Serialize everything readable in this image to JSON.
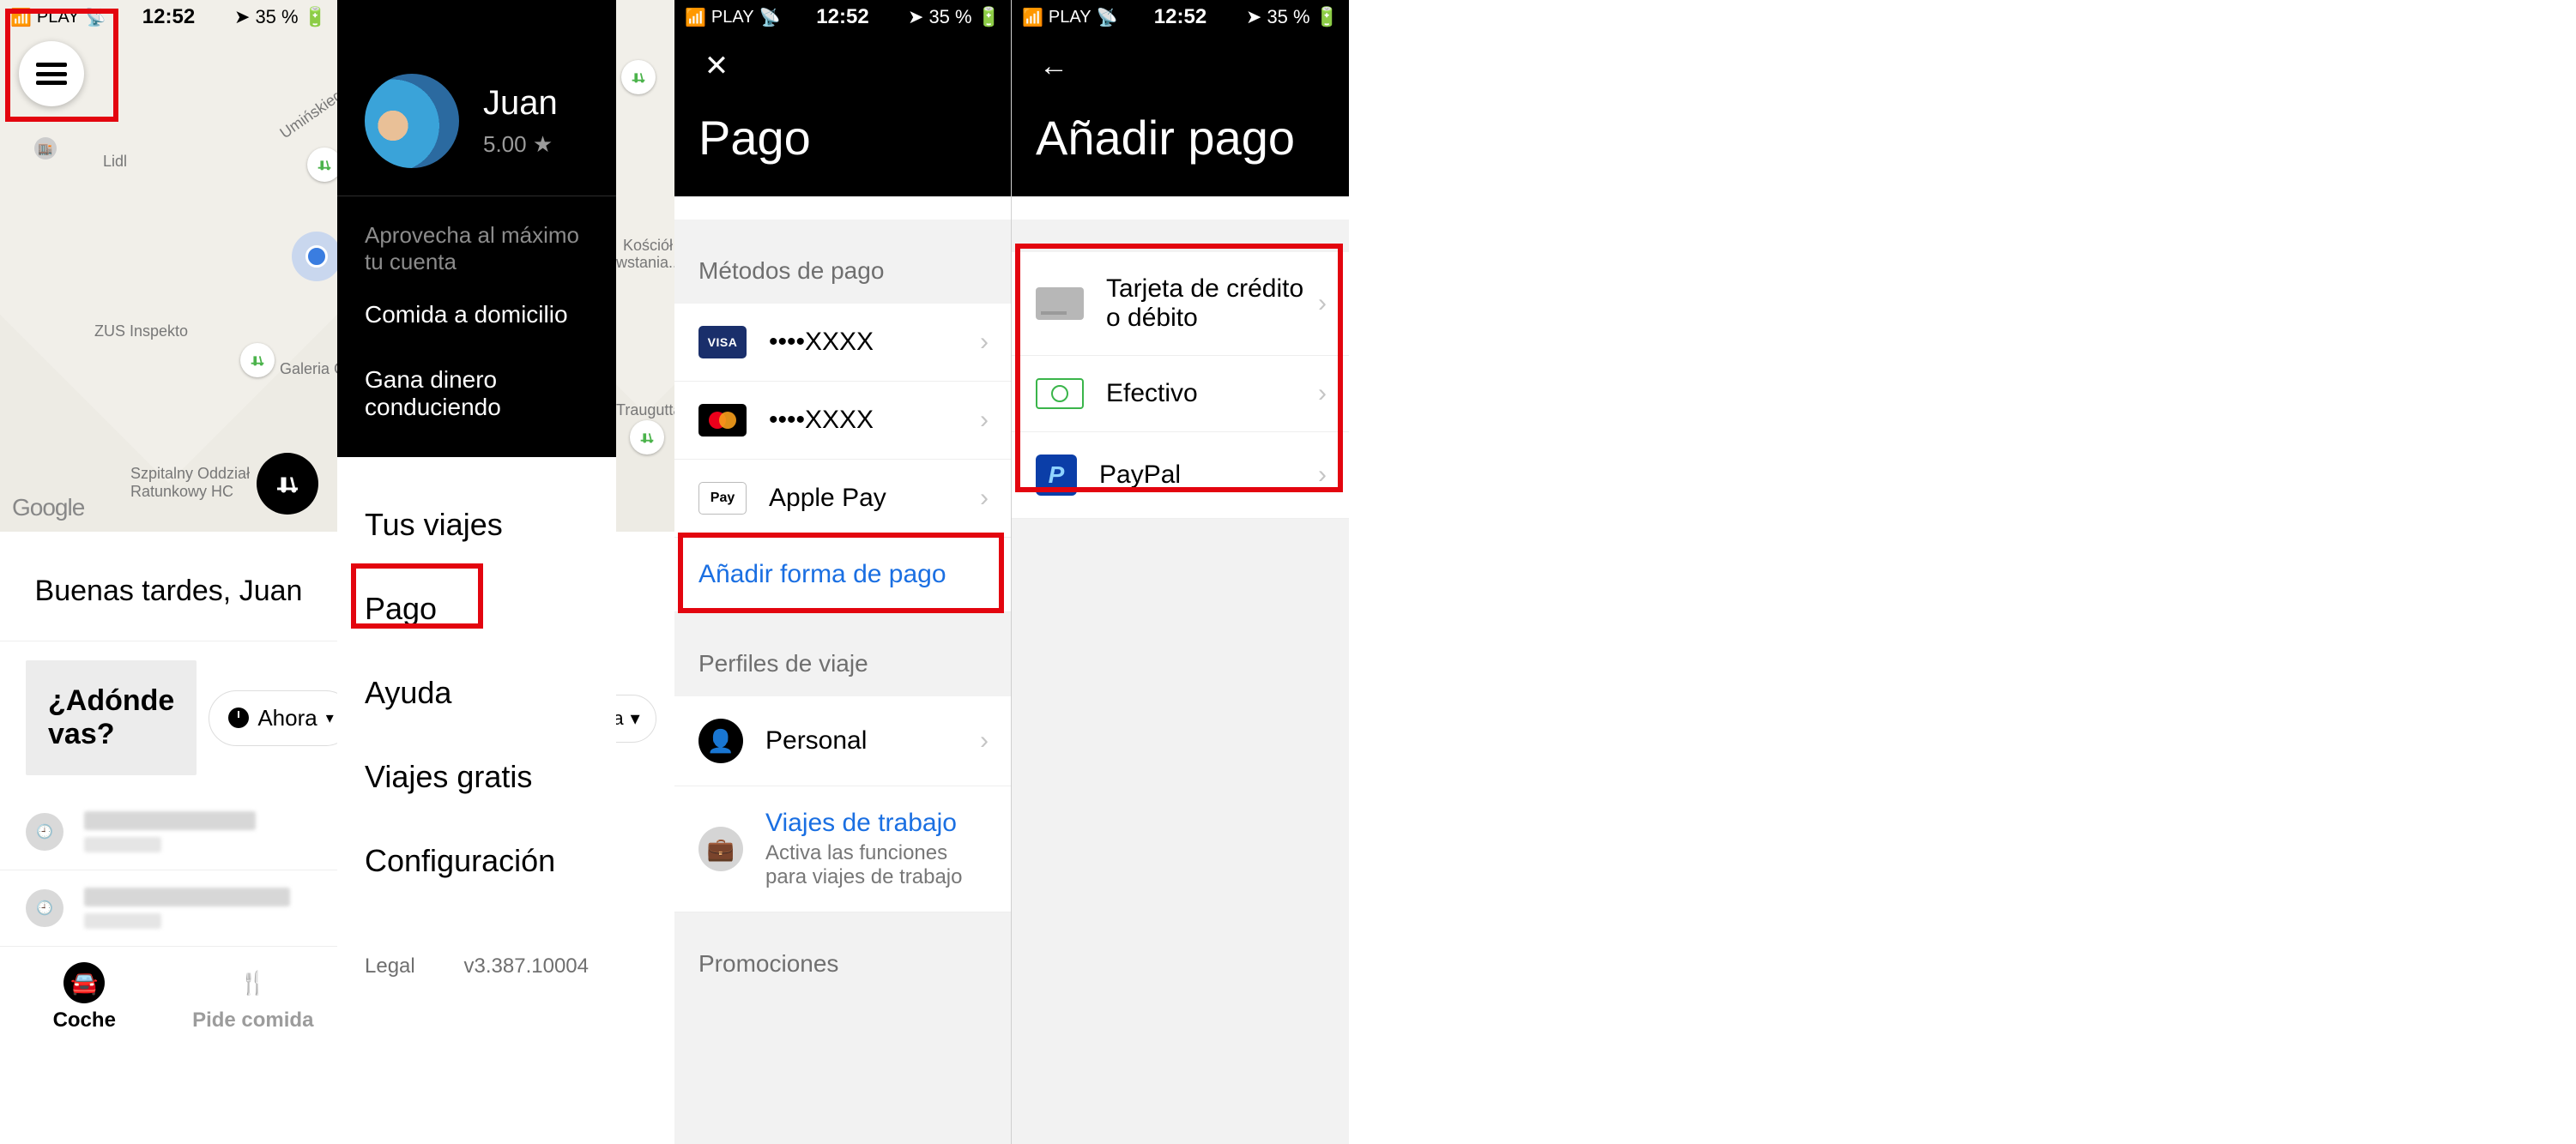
{
  "status": {
    "carrier": "PLAY",
    "time": "12:52",
    "battery": "35 %"
  },
  "home": {
    "greeting": "Buenas tardes, Juan",
    "search_placeholder": "¿Adónde vas?",
    "now_label": "Ahora",
    "tabs": {
      "car": "Coche",
      "food": "Pide comida"
    },
    "map_labels": {
      "lidl": "Lidl",
      "zus": "ZUS Inspekto",
      "galeria": "Galeria Green Point",
      "kosciol": "Kościół",
      "wstania": "wstania...",
      "traugutta": "Traugutta",
      "szpital": "Szpitalny Oddział\nRatunkowy HC",
      "google": "Google",
      "uminskiego": "Umińskiego"
    }
  },
  "drawer": {
    "name": "Juan",
    "rating": "5.00 ★",
    "promo_header": "Aprovecha al máximo tu cuenta",
    "promo_links": [
      "Comida a domicilio",
      "Gana dinero conduciendo"
    ],
    "items": [
      "Tus viajes",
      "Pago",
      "Ayuda",
      "Viajes gratis",
      "Configuración"
    ],
    "legal": "Legal",
    "version": "v3.387.10004"
  },
  "sliver": {
    "now_short": "ra"
  },
  "pago": {
    "title": "Pago",
    "methods_label": "Métodos de pago",
    "methods": [
      {
        "type": "visa",
        "label": "••••XXXX"
      },
      {
        "type": "mc",
        "label": "••••XXXX"
      },
      {
        "type": "apple",
        "label": "Apple Pay"
      }
    ],
    "add_label": "Añadir forma de pago",
    "profiles_label": "Perfiles de viaje",
    "profiles": [
      {
        "title": "Personal"
      },
      {
        "title": "Viajes de trabajo",
        "sub": "Activa las funciones para viajes de trabajo"
      }
    ],
    "promos_label": "Promociones"
  },
  "addpay": {
    "title": "Añadir pago",
    "options": [
      "Tarjeta de crédito o débito",
      "Efectivo",
      "PayPal"
    ]
  }
}
